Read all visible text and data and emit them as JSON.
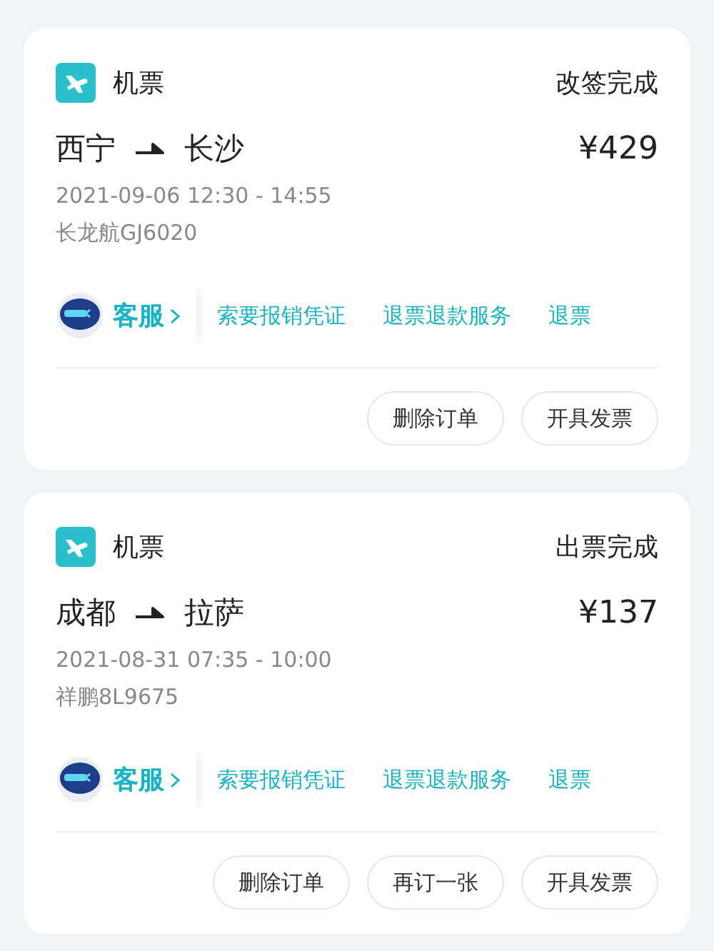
{
  "orders": [
    {
      "category": "机票",
      "status": "改签完成",
      "from": "西宁",
      "to": "长沙",
      "price": "¥429",
      "time": "2021-09-06 12:30 - 14:55",
      "flight": "长龙航GJ6020",
      "service": "客服",
      "links": [
        "索要报销凭证",
        "退票退款服务",
        "退票"
      ],
      "buttons": [
        "删除订单",
        "开具发票"
      ]
    },
    {
      "category": "机票",
      "status": "出票完成",
      "from": "成都",
      "to": "拉萨",
      "price": "¥137",
      "time": "2021-08-31 07:35 - 10:00",
      "flight": "祥鹏8L9675",
      "service": "客服",
      "links": [
        "索要报销凭证",
        "退票退款服务",
        "退票"
      ],
      "buttons": [
        "删除订单",
        "再订一张",
        "开具发票"
      ]
    }
  ]
}
